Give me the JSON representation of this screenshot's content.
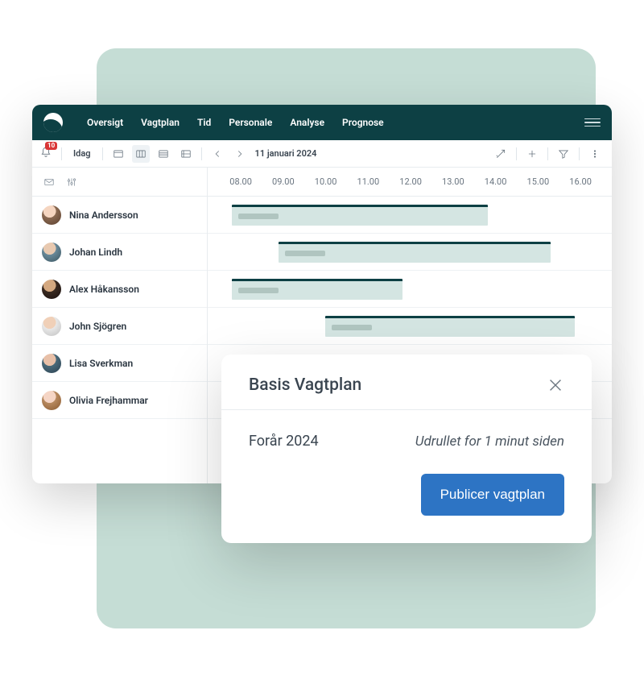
{
  "nav": {
    "items": [
      "Oversigt",
      "Vagtplan",
      "Tid",
      "Personale",
      "Analyse",
      "Prognose"
    ]
  },
  "toolbar": {
    "notification_count": "10",
    "today_label": "Idag",
    "date_label": "11 januari 2024"
  },
  "time_header": [
    "08.00",
    "09.00",
    "10.00",
    "11.00",
    "12.00",
    "13.00",
    "14.00",
    "15.00",
    "16.00"
  ],
  "employees": [
    {
      "name": "Nina Andersson"
    },
    {
      "name": "Johan Lindh"
    },
    {
      "name": "Alex Håkansson"
    },
    {
      "name": "John Sjögren"
    },
    {
      "name": "Lisa Sverkman"
    },
    {
      "name": "Olivia Frejhammar"
    }
  ],
  "modal": {
    "title": "Basis Vagtplan",
    "season": "Forår 2024",
    "status": "Udrullet for 1 minut siden",
    "publish_label": "Publicer vagtplan"
  }
}
